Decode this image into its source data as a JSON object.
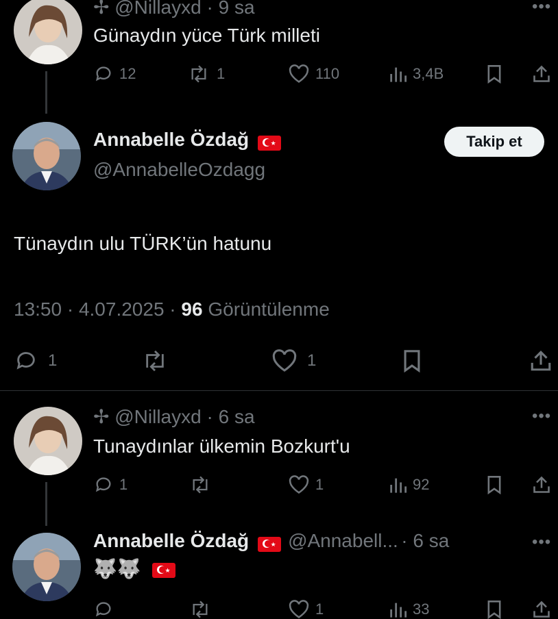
{
  "tweet1": {
    "handle_prefix": "✢",
    "handle": "@Nillayxd",
    "time": "· 9 sa",
    "text": "Günaydın yüce Türk milleti",
    "replies": "12",
    "retweets": "1",
    "likes": "110",
    "views": "3,4B"
  },
  "main": {
    "name": "Annabelle Özdağ",
    "handle": "@AnnabelleOzdagg",
    "follow_label": "Takip et",
    "text": "Tünaydın ulu TÜRK’ün hatunu",
    "timestamp": "13:50 · 4.07.2025 ·",
    "views_count": "96",
    "views_label": "Görüntülenme",
    "replies": "1",
    "likes": "1"
  },
  "tweet3": {
    "handle_prefix": "✢",
    "handle": "@Nillayxd",
    "time": "· 6 sa",
    "text": "Tunaydınlar ülkemin Bozkurt'u",
    "replies": "1",
    "likes": "1",
    "views": "92"
  },
  "tweet4": {
    "name": "Annabelle Özdağ",
    "handle": "@Annabell...",
    "time": "· 6 sa",
    "text": "🐺🐺",
    "likes": "1",
    "views": "33"
  },
  "colors": {
    "background": "#000000",
    "text": "#e7e9ea",
    "muted": "#71767b",
    "follow_bg": "#eff3f4",
    "flag": "#e30a17"
  }
}
